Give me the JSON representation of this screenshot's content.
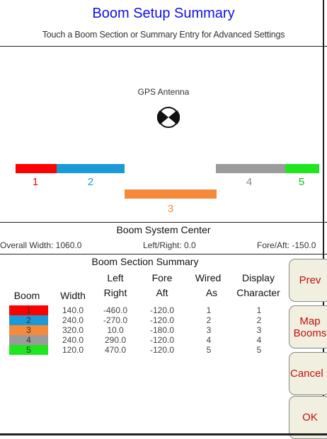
{
  "header": {
    "title": "Boom Setup Summary",
    "subtitle": "Touch a Boom Section or Summary Entry for Advanced Settings"
  },
  "diagram": {
    "gps_label": "GPS Antenna",
    "gps_icon": "gps-antenna-icon",
    "sections": [
      {
        "number": "1",
        "color": "#ff0000",
        "number_color": "#e01010"
      },
      {
        "number": "2",
        "color": "#1a9bd7",
        "number_color": "#1a9bd7"
      },
      {
        "number": "3",
        "color": "#f58b3a",
        "number_color": "#f58b3a"
      },
      {
        "number": "4",
        "color": "#9b9b9b",
        "number_color": "#8a8a8a"
      },
      {
        "number": "5",
        "color": "#1fe61f",
        "number_color": "#18c018"
      }
    ]
  },
  "boom_center": {
    "title": "Boom System Center",
    "overall_width": "Overall Width: 1060.0",
    "left_right": "Left/Right: 0.0",
    "fore_aft": "Fore/Aft: -150.0"
  },
  "section_summary": {
    "title": "Boom Section Summary",
    "headers": {
      "boom": "Boom",
      "width": "Width",
      "left_right_1": "Left",
      "left_right_2": "Right",
      "fore_aft_1": "Fore",
      "fore_aft_2": "Aft",
      "wired_1": "Wired",
      "wired_2": "As",
      "display_1": "Display",
      "display_2": "Character"
    },
    "rows": [
      {
        "boom": "1",
        "color": "#ff0000",
        "width": "140.0",
        "left_right": "-460.0",
        "fore_aft": "-120.0",
        "wired_as": "1",
        "display": "1"
      },
      {
        "boom": "2",
        "color": "#1a9bd7",
        "width": "240.0",
        "left_right": "-270.0",
        "fore_aft": "-120.0",
        "wired_as": "2",
        "display": "2"
      },
      {
        "boom": "3",
        "color": "#f58b3a",
        "width": "320.0",
        "left_right": "10.0",
        "fore_aft": "-180.0",
        "wired_as": "3",
        "display": "3"
      },
      {
        "boom": "4",
        "color": "#9b9b9b",
        "width": "240.0",
        "left_right": "290.0",
        "fore_aft": "-120.0",
        "wired_as": "4",
        "display": "4"
      },
      {
        "boom": "5",
        "color": "#1fe61f",
        "width": "120.0",
        "left_right": "470.0",
        "fore_aft": "-120.0",
        "wired_as": "5",
        "display": "5"
      }
    ]
  },
  "buttons": {
    "prev": "Prev",
    "map_booms": "Map\nBooms",
    "cancel": "Cancel",
    "ok": "OK"
  }
}
